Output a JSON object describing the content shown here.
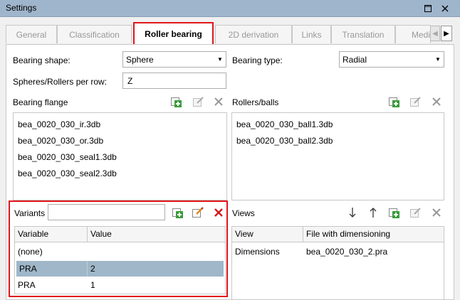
{
  "window": {
    "title": "Settings"
  },
  "tabs": [
    {
      "label": "General",
      "active": false
    },
    {
      "label": "Classification",
      "active": false
    },
    {
      "label": "Roller bearing",
      "active": true
    },
    {
      "label": "2D derivation",
      "active": false
    },
    {
      "label": "Links",
      "active": false
    },
    {
      "label": "Translation",
      "active": false
    },
    {
      "label": "Medi",
      "active": false
    }
  ],
  "form": {
    "bearing_shape_label": "Bearing shape:",
    "bearing_shape_value": "Sphere",
    "bearing_type_label": "Bearing type:",
    "bearing_type_value": "Radial",
    "rows_label": "Spheres/Rollers per row:",
    "rows_value": "Z"
  },
  "bearing_flange": {
    "label": "Bearing flange",
    "items": [
      "bea_0020_030_ir.3db",
      "bea_0020_030_or.3db",
      "bea_0020_030_seal1.3db",
      "bea_0020_030_seal2.3db"
    ]
  },
  "rollers_balls": {
    "label": "Rollers/balls",
    "items": [
      "bea_0020_030_ball1.3db",
      "bea_0020_030_ball2.3db"
    ]
  },
  "variants": {
    "label": "Variants",
    "name_value": "",
    "columns": [
      "Variable",
      "Value"
    ],
    "rows": [
      {
        "variable": "(none)",
        "value": "",
        "selected": false
      },
      {
        "variable": "PRA",
        "value": "2",
        "selected": true
      },
      {
        "variable": "PRA",
        "value": "1",
        "selected": false
      }
    ]
  },
  "views": {
    "label": "Views",
    "columns": [
      "View",
      "File with dimensioning"
    ],
    "rows": [
      {
        "view": "Dimensions",
        "file": "bea_0020_030_2.pra"
      }
    ]
  },
  "colors": {
    "highlight": "#e0161b",
    "selected_row": "#9fb7c9",
    "titlebar": "#9fb5cc"
  }
}
